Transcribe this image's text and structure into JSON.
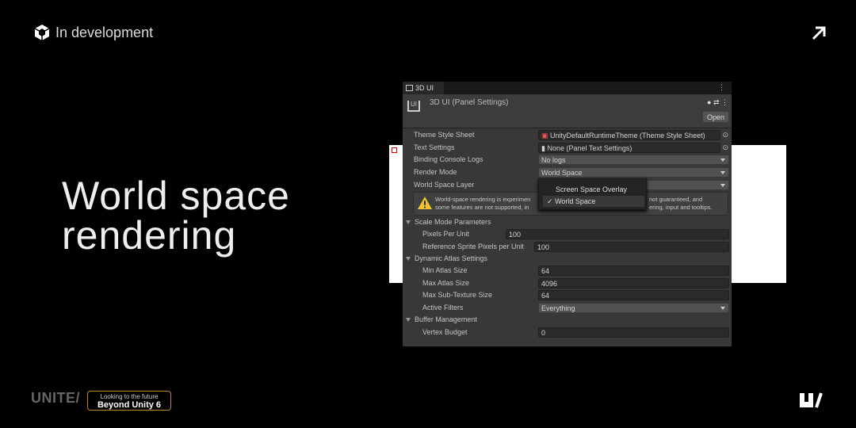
{
  "brand": {
    "label": "In development"
  },
  "title": {
    "line1": "World space",
    "line2": "rendering"
  },
  "footer": {
    "unite": "UNITE/",
    "tagline": "Looking to the future",
    "event": "Beyond Unity 6"
  },
  "colors": {
    "background": "#000000",
    "panel": "#383838",
    "accent_border": "#b8862b",
    "warning": "#f2c12e"
  },
  "inspector": {
    "tab": "3D UI",
    "header_title": "3D UI (Panel Settings)",
    "open_button": "Open",
    "rows": [
      {
        "label": "Theme Style Sheet",
        "value": "UnityDefaultRuntimeTheme (Theme Style Sheet)"
      },
      {
        "label": "Text Settings",
        "value": "None (Panel Text Settings)"
      },
      {
        "label": "Binding Console Logs",
        "value": "No logs"
      },
      {
        "label": "Render Mode",
        "value": "World Space"
      },
      {
        "label": "World Space Layer",
        "value": ""
      }
    ],
    "warning": {
      "l1a": "World-space rendering is experimen",
      "l1b": "not guaranteed, and",
      "l2a": "some features are not supported, in",
      "l2b": "ering, input and tooltips."
    },
    "menu": {
      "options": [
        "Screen Space Overlay",
        "World Space"
      ],
      "selected": "World Space",
      "check": "✓"
    },
    "scale": {
      "title": "Scale Mode Parameters",
      "rows": [
        {
          "label": "Pixels Per Unit",
          "value": "100"
        },
        {
          "label": "Reference Sprite Pixels per Unit",
          "value": "100"
        }
      ]
    },
    "atlas": {
      "title": "Dynamic Atlas Settings",
      "rows": [
        {
          "label": "Min Atlas Size",
          "value": "64"
        },
        {
          "label": "Max Atlas Size",
          "value": "4096"
        },
        {
          "label": "Max Sub-Texture Size",
          "value": "64"
        },
        {
          "label": "Active Filters",
          "value": "Everything"
        }
      ]
    },
    "buffer": {
      "title": "Buffer Management",
      "rows": [
        {
          "label": "Vertex Budget",
          "value": "0"
        }
      ]
    }
  }
}
